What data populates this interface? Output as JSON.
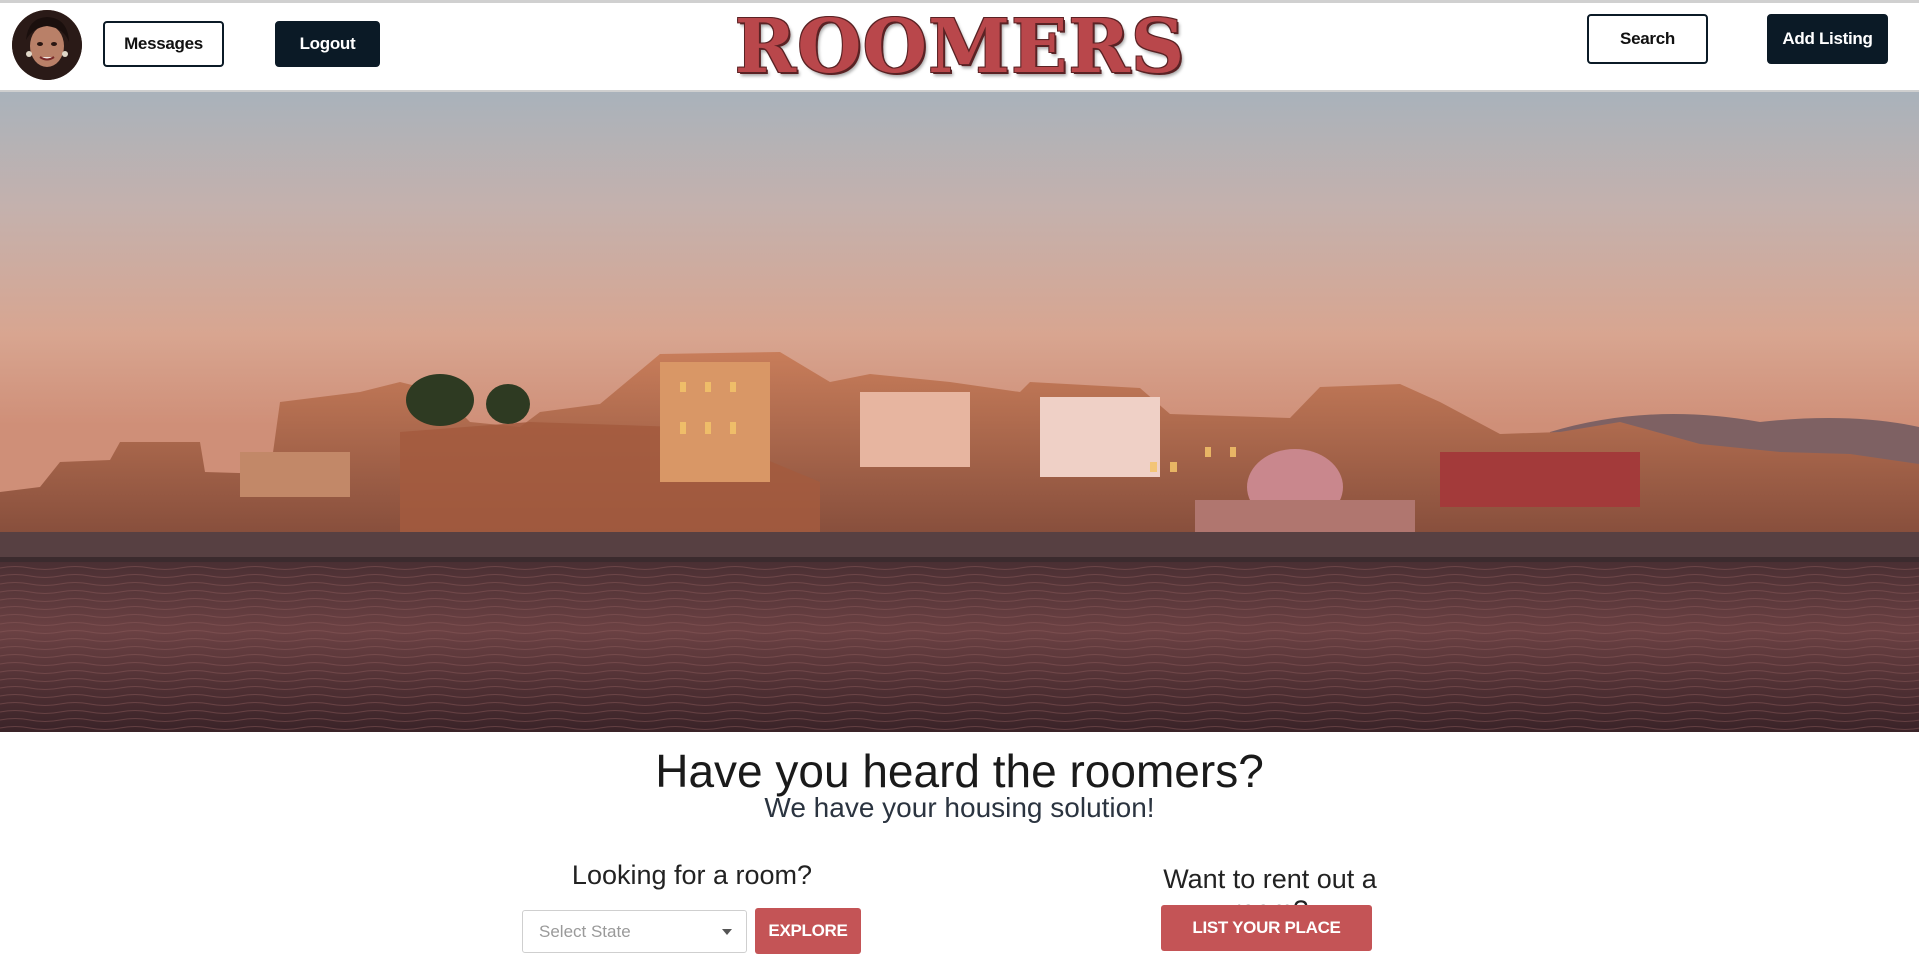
{
  "nav": {
    "messages_label": "Messages",
    "logout_label": "Logout",
    "logo_text": "ROOMERS",
    "search_label": "Search",
    "add_listing_label": "Add Listing"
  },
  "hero": {
    "title": "Have you heard the roomers?",
    "subtitle": "We have your housing solution!"
  },
  "find": {
    "label": "Looking for a room?",
    "select_placeholder": "Select State",
    "explore_label": "EXPLORE"
  },
  "rent": {
    "label": "Want to rent out a room?",
    "list_label": "LIST YOUR PLACE"
  },
  "colors": {
    "brand_red": "#c45456",
    "dark_navy": "#0b1a26"
  }
}
